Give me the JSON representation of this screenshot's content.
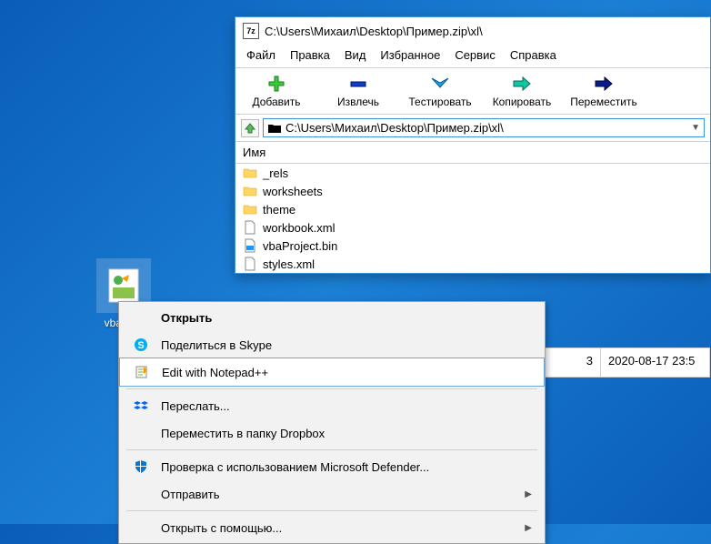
{
  "desktop": {
    "icon_label": "vbaPr..."
  },
  "window": {
    "title": "C:\\Users\\Михаил\\Desktop\\Пример.zip\\xl\\",
    "menu": [
      "Файл",
      "Правка",
      "Вид",
      "Избранное",
      "Сервис",
      "Справка"
    ],
    "toolbar": [
      {
        "label": "Добавить",
        "icon": "plus"
      },
      {
        "label": "Извлечь",
        "icon": "minus"
      },
      {
        "label": "Тестировать",
        "icon": "check"
      },
      {
        "label": "Копировать",
        "icon": "arrow-right"
      },
      {
        "label": "Переместить",
        "icon": "arrow-right-dark"
      }
    ],
    "path": "C:\\Users\\Михаил\\Desktop\\Пример.zip\\xl\\",
    "column_header": "Имя",
    "files": [
      {
        "name": "_rels",
        "type": "folder"
      },
      {
        "name": "worksheets",
        "type": "folder"
      },
      {
        "name": "theme",
        "type": "folder"
      },
      {
        "name": "workbook.xml",
        "type": "file"
      },
      {
        "name": "vbaProject.bin",
        "type": "bin"
      },
      {
        "name": "styles.xml",
        "type": "file"
      }
    ],
    "status_left": "3",
    "status_right": "2020-08-17 23:5"
  },
  "context_menu": {
    "items": [
      {
        "label": "Открыть",
        "bold": true
      },
      {
        "label": "Поделиться в Skype",
        "icon": "skype"
      },
      {
        "label": "Edit with Notepad++",
        "icon": "notepad",
        "hover": true
      },
      {
        "sep": true
      },
      {
        "label": "Переслать...",
        "icon": "dropbox"
      },
      {
        "label": "Переместить в папку Dropbox"
      },
      {
        "sep": true
      },
      {
        "label": "Проверка с использованием Microsoft Defender...",
        "icon": "defender"
      },
      {
        "label": "Отправить",
        "submenu": true
      },
      {
        "sep": true
      },
      {
        "label": "Открыть с помощью...",
        "submenu": true
      }
    ]
  }
}
